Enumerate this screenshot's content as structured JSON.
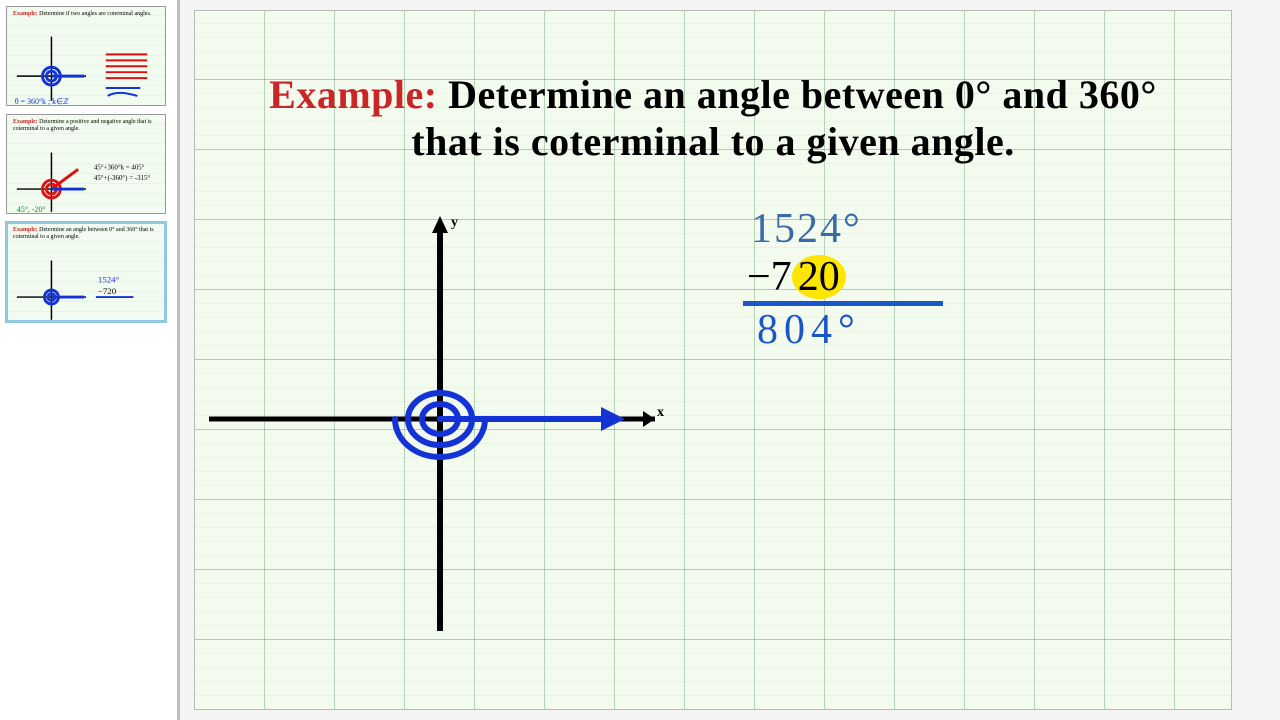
{
  "sidebar": {
    "thumbs": [
      {
        "title_prefix": "Example:",
        "title_rest": " Determine if two angles are coterminal angles.",
        "selected": false
      },
      {
        "title_prefix": "Example:",
        "title_rest": " Determine a positive and negative angle that is coterminal to a given angle.",
        "selected": false
      },
      {
        "title_prefix": "Example:",
        "title_rest": " Determine an angle between 0° and 360° that is coterminal to a given angle.",
        "selected": true
      }
    ]
  },
  "slide": {
    "title_prefix": "Example:",
    "title_rest": " Determine an angle between 0° and 360° that is coterminal to a given angle.",
    "axis_labels": {
      "x": "x",
      "y": "y"
    }
  },
  "math": {
    "line1": "1524°",
    "line2_a": "−7",
    "line2_hl": "20",
    "line3": "804°"
  }
}
